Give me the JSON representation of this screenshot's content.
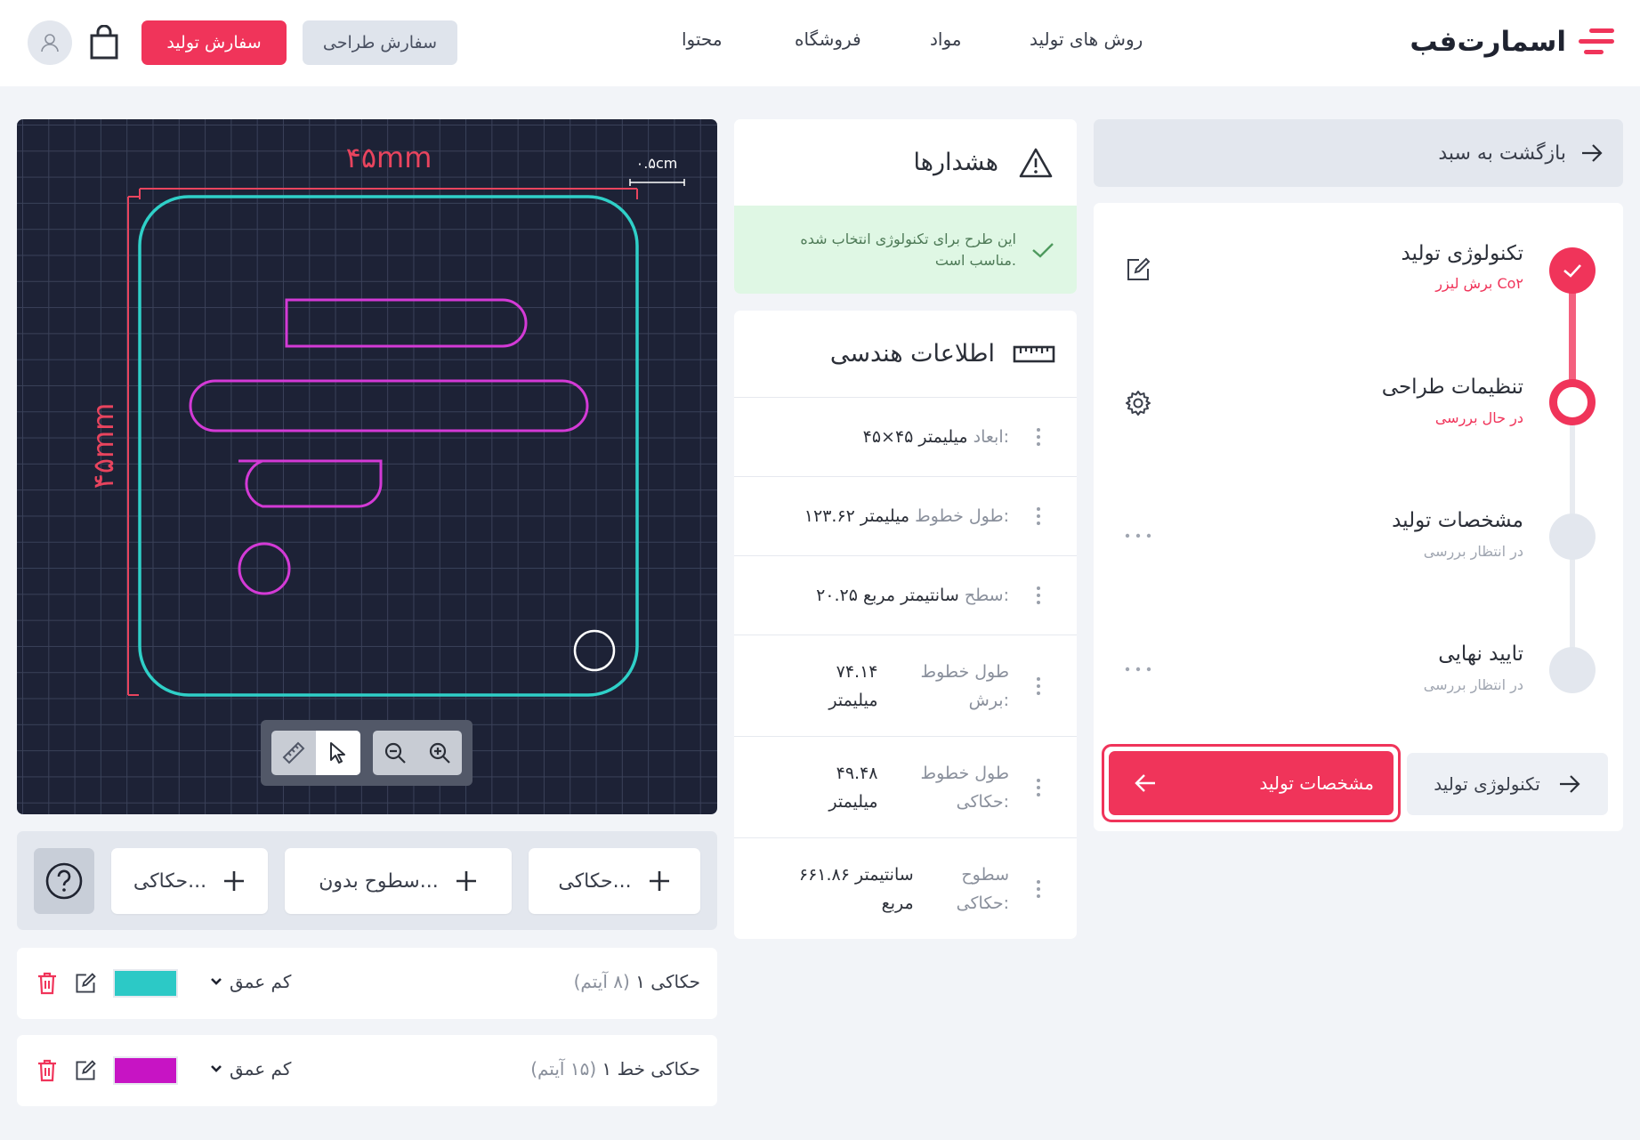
{
  "header": {
    "logo_text": "اسمارت‌فب",
    "nav": [
      "روش های تولید",
      "مواد",
      "فروشگاه",
      "محتوا"
    ],
    "design_order_label": "سفارش طراحی",
    "production_order_label": "سفارش تولید"
  },
  "sidebar": {
    "back_label": "بازگشت به سبد",
    "steps": [
      {
        "title": "تکنولوژی تولید",
        "subtitle": "برش لیزر Co۲",
        "state": "done"
      },
      {
        "title": "تنظیمات طراحی",
        "subtitle": "در حال بررسی",
        "state": "active"
      },
      {
        "title": "مشخصات تولید",
        "subtitle": "در انتظار بررسی",
        "state": "pending"
      },
      {
        "title": "تایید نهایی",
        "subtitle": "در انتظار بررسی",
        "state": "pending"
      }
    ],
    "prev_button": "تکنولوژی تولید",
    "next_button": "مشخصات تولید"
  },
  "warnings": {
    "title": "هشدارها",
    "message_line1": "این طرح برای تکنولوژی انتخاب شده",
    "message_line2": "مناسب است."
  },
  "geometry": {
    "title": "اطلاعات هندسی",
    "rows": [
      {
        "label": "ابعاد:",
        "value": "۴۵×۴۵ میلیمتر"
      },
      {
        "label": "طول خطوط:",
        "value": "۱۲۳.۶۲ میلیمتر"
      },
      {
        "label": "سطح:",
        "value": "۲۰.۲۵ سانتیمتر مربع"
      },
      {
        "label1": "طول خطوط",
        "label2": "برش:",
        "value1": "۷۴.۱۴",
        "value2": "میلیمتر"
      },
      {
        "label1": "طول خطوط",
        "label2": "حکاکی:",
        "value1": "۴۹.۴۸",
        "value2": "میلیمتر"
      },
      {
        "label1": "سطوح",
        "label2": "حکاکی:",
        "value1": "۶۶۱.۸۶  سانتیمتر",
        "value2": "مربع"
      }
    ]
  },
  "canvas": {
    "width_label": "۴۵mm",
    "height_label": "۴۵mm",
    "margin_label": "۰.۵cm",
    "grid_color": "#3a4159",
    "outline_color": "#2fd0c8",
    "engrave_color": "#d33ad6",
    "dimension_color": "#e8445e"
  },
  "tools": {
    "add_buttons": [
      "حکاکی...",
      "سطوح بدون...",
      "حکاکی..."
    ]
  },
  "layers": [
    {
      "name": "حکاکی ۱",
      "count": "(۸ آیتم)",
      "depth": "کم عمق",
      "color": "#2cc9c6"
    },
    {
      "name": "حکاکی خط ۱",
      "count": "(۱۵ آیتم)",
      "depth": "کم عمق",
      "color": "#c714c4"
    }
  ],
  "colors": {
    "accent": "#f0345a",
    "success_bg": "#dff7e4"
  }
}
